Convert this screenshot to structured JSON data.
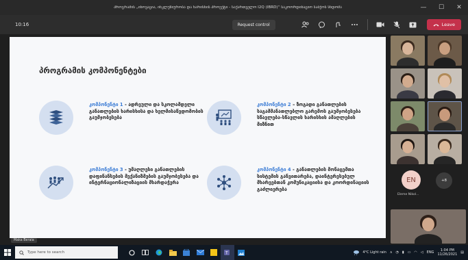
{
  "window": {
    "title": "პროგრამის „ინოვაცია, ინკლუზიურობა და ხარისხის პროექტი - საქართველო I2Q (IBRD)“ საკოორდინაციო საბჭოს სხდომა"
  },
  "toolbar": {
    "timer": "10:16",
    "request_control_label": "Request control",
    "leave_label": "Leave"
  },
  "slide": {
    "title": "პროგრამის კომპონენტები",
    "components": [
      {
        "heading": "კომპონენტი 1",
        "body": " - ადრეული და სკოლამდელი განათლების ხარისხისა და ხელმისაწვდომობის გაუმჯობესება",
        "icon": "books-icon"
      },
      {
        "heading": "კომპონენტი 2",
        "body": " – ზოგადი განათლების საგამმანათლებლო გარემოს გაუმჯობესება სწავლება-სწავლის ხარისხის ამაღლების მიზნით",
        "icon": "classroom-icon"
      },
      {
        "heading": "კომპონენტი 3",
        "body": " - უმაღლესი განათლების დაფინანსების მექანიზმების გაუმჯობესება და ინტერნაციონალიზაციის მხარდაჭერა",
        "icon": "growth-people-icon"
      },
      {
        "heading": "კომპონენტი 4",
        "body": " - განათლების მონაცემთა სისტემის განვითარება, დაინტერესებულ მხარეებთან კომუნიკაციისა და კოორდინაციის გაძლიერება",
        "icon": "network-icon"
      }
    ],
    "presenter": "Maka Beraia"
  },
  "gallery": {
    "avatar_initials": "EN",
    "avatar_name": "Eleme Nikol...",
    "more_count": "+8"
  },
  "taskbar": {
    "search_placeholder": "Type here to search",
    "weather": "4°C Light rain",
    "lang": "ENG",
    "time": "1:04 PM",
    "date": "11/26/2021"
  },
  "colors": {
    "accent_blue": "#3a7bd5",
    "leave_red": "#c4314b",
    "icon_circle": "#d4dff0"
  }
}
